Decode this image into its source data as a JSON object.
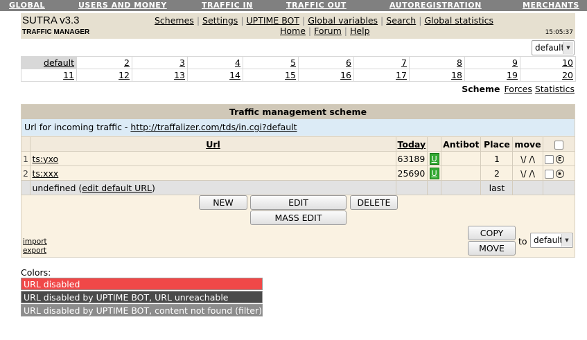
{
  "nav": [
    {
      "label": "GLOBAL"
    },
    {
      "label": "USERS AND MONEY"
    },
    {
      "label": "TRAFFIC IN"
    },
    {
      "label": "TRAFFIC OUT"
    },
    {
      "label": "AUTOREGISTRATION"
    },
    {
      "label": "MERCHANTS"
    }
  ],
  "header": {
    "title": "SUTRA v3.3",
    "subtitle": "TRAFFIC MANAGER",
    "clock": "15:05:37",
    "links_row1": [
      "Schemes",
      "Settings",
      "UPTIME BOT",
      "Global variables",
      "Search",
      "Global statistics"
    ],
    "links_row2": [
      "Home",
      "Forum",
      "Help"
    ],
    "separator": "|"
  },
  "scheme_select": {
    "value": "default"
  },
  "schemes": {
    "row1": [
      "default",
      "2",
      "3",
      "4",
      "5",
      "6",
      "7",
      "8",
      "9",
      "10"
    ],
    "row2": [
      "11",
      "12",
      "13",
      "14",
      "15",
      "16",
      "17",
      "18",
      "19",
      "20"
    ],
    "active": "default"
  },
  "view_links": {
    "current": "Scheme",
    "forces": "Forces",
    "statistics": "Statistics"
  },
  "panel": {
    "title": "Traffic management scheme",
    "incoming_label": "Url for incoming traffic - ",
    "incoming_url": "http://traffalizer.com/tds/in.cgi?default",
    "columns": {
      "url": "Url",
      "today": "Today",
      "antibot": "Antibot",
      "place": "Place",
      "move": "move"
    },
    "rows": [
      {
        "num": "1",
        "url": "ts:yxo",
        "today": "63189",
        "badge": "U",
        "place": "1",
        "move": "\\/ /\\",
        "edit_icon": "E"
      },
      {
        "num": "2",
        "url": "ts:xxx",
        "today": "25690",
        "badge": "U",
        "place": "2",
        "move": "\\/ /\\",
        "edit_icon": "E"
      }
    ],
    "undefined_row": {
      "text_before": "undefined (",
      "link": "edit default URL",
      "text_after": ")",
      "place": "last"
    },
    "buttons": {
      "new": "NEW",
      "edit": "EDIT",
      "delete": "DELETE",
      "mass_edit": "MASS EDIT",
      "copy": "COPY",
      "move": "MOVE"
    },
    "to_label": "to",
    "target_select": {
      "value": "default"
    },
    "import": "import",
    "export": "export"
  },
  "legend": {
    "title": "Colors:",
    "items": [
      {
        "label": "URL disabled",
        "color": "#f04848",
        "text_color": "#ffffff"
      },
      {
        "label": "URL disabled by UPTIME BOT, URL unreachable",
        "color": "#4a4a4a",
        "text_color": "#ffffff"
      },
      {
        "label": "URL disabled by UPTIME BOT, content not found (filter)",
        "color": "#8c8c8c",
        "text_color": "#ffffff"
      }
    ]
  }
}
